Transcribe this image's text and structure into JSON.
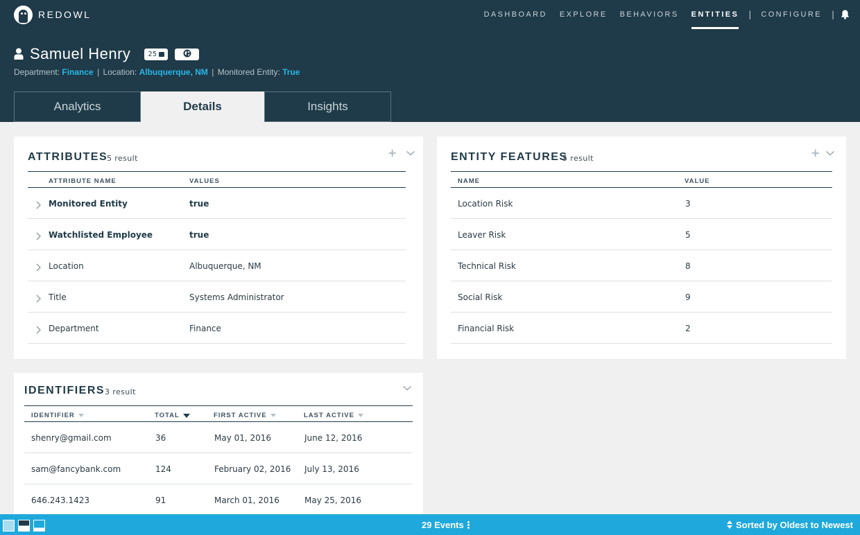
{
  "brand": {
    "name": "REDOWL"
  },
  "nav": {
    "items": [
      {
        "label": "DASHBOARD",
        "active": false
      },
      {
        "label": "EXPLORE",
        "active": false
      },
      {
        "label": "BEHAVIORS",
        "active": false
      },
      {
        "label": "ENTITIES",
        "active": true
      },
      {
        "label": "CONFIGURE",
        "active": false
      }
    ],
    "separator": "|"
  },
  "entity": {
    "name": "Samuel Henry",
    "message_count": "25",
    "department_label": "Department:",
    "department": "Finance",
    "location_label": "Location:",
    "location": "Albuquerque, NM",
    "monitored_label": "Monitored Entity:",
    "monitored": "True",
    "separator": "|"
  },
  "tabs": [
    {
      "label": "Analytics",
      "active": false
    },
    {
      "label": "Details",
      "active": true
    },
    {
      "label": "Insights",
      "active": false
    }
  ],
  "attributes": {
    "title": "ATTRIBUTES",
    "count": "5 result",
    "plus": "+",
    "columns": [
      "ATTRIBUTE NAME",
      "VALUES"
    ],
    "rows": [
      {
        "name": "Monitored Entity",
        "value": "true",
        "bold": true
      },
      {
        "name": "Watchlisted Employee",
        "value": "true",
        "bold": true
      },
      {
        "name": "Location",
        "value": "Albuquerque, NM",
        "bold": false
      },
      {
        "name": "Title",
        "value": "Systems Administrator",
        "bold": false
      },
      {
        "name": "Department",
        "value": "Finance",
        "bold": false
      }
    ]
  },
  "features": {
    "title": "ENTITY FEATURES",
    "count": "5 result",
    "plus": "+",
    "columns": [
      "NAME",
      "VALUE"
    ],
    "rows": [
      {
        "name": "Location Risk",
        "value": "3"
      },
      {
        "name": "Leaver Risk",
        "value": "5"
      },
      {
        "name": "Technical Risk",
        "value": "8"
      },
      {
        "name": "Social Risk",
        "value": "9"
      },
      {
        "name": "Financial Risk",
        "value": "2"
      }
    ]
  },
  "identifiers": {
    "title": "IDENTIFIERS",
    "count": "3 result",
    "columns": [
      "IDENTIFIER",
      "TOTAL",
      "FIRST ACTIVE",
      "LAST ACTIVE"
    ],
    "rows": [
      {
        "identifier": "shenry@gmail.com",
        "total": "36",
        "first": "May 01, 2016",
        "last": "June 12, 2016"
      },
      {
        "identifier": "sam@fancybank.com",
        "total": "124",
        "first": "February 02, 2016",
        "last": "July 13, 2016"
      },
      {
        "identifier": "646.243.1423",
        "total": "91",
        "first": "March 01, 2016",
        "last": "May 25, 2016"
      }
    ]
  },
  "footer": {
    "events": "29 Events",
    "sort": "Sorted by Oldest to Newest"
  },
  "colors": {
    "header_bg": "#1f3a48",
    "accent": "#28b7e6",
    "footer_bg": "#1fa8db"
  }
}
